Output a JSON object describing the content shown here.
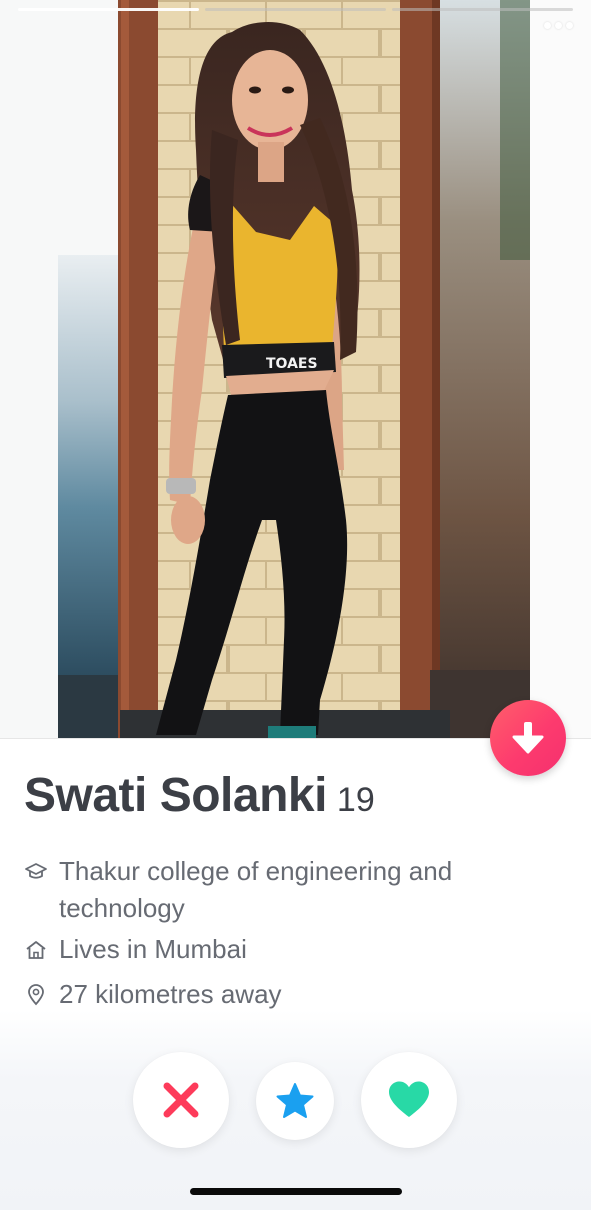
{
  "profile": {
    "name": "Swati Solanki",
    "age": "19",
    "details": [
      {
        "icon": "graduation-cap-icon",
        "text": "Thakur college of engineering and technology"
      },
      {
        "icon": "home-icon",
        "text": "Lives in Mumbai"
      },
      {
        "icon": "location-pin-icon",
        "text": "27 kilometres away"
      }
    ]
  },
  "photo": {
    "count": 3,
    "active_index": 0
  },
  "actions": {
    "nope_icon": "close-icon",
    "super_like_icon": "star-icon",
    "like_icon": "heart-icon",
    "show_more_icon": "arrow-down-icon",
    "more_options_icon": "more-dots-icon"
  },
  "colors": {
    "nope": "#fd3b5a",
    "super_like": "#1aa0f0",
    "like": "#28d9a6",
    "show_more_gradient_start": "#ff5f6a",
    "show_more_gradient_end": "#f4306f",
    "text_dark": "#3c3f46",
    "text_muted": "#676b73"
  }
}
